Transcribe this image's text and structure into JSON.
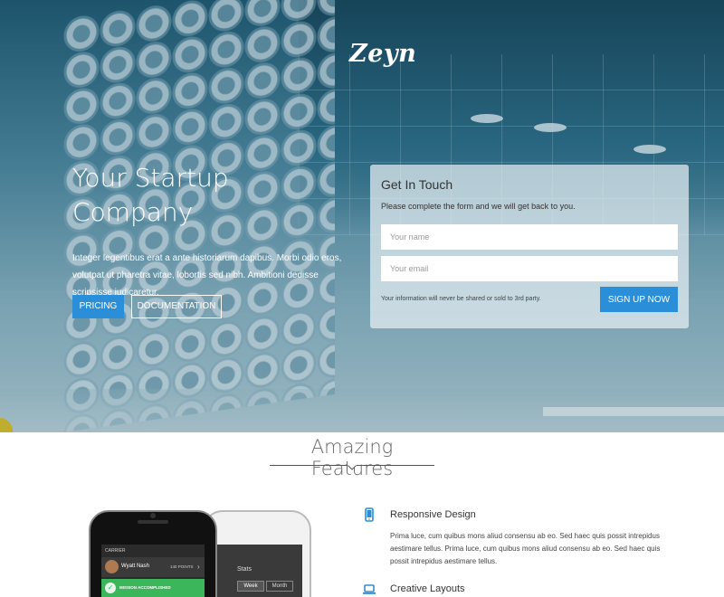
{
  "brand": {
    "logo": "Zeyn"
  },
  "hero": {
    "headline_line1": "Your Startup",
    "headline_line2": "Company",
    "lead": "Integer legentibus erat a ante historiarum dapibus. Morbi odio eros, volutpat ut pharetra vitae, lobortis sed nibh. Ambitioni dedisse scripsisse iudicaretur.",
    "pricing_label": "PRICING",
    "docs_label": "DOCUMENTATION"
  },
  "contact_form": {
    "title": "Get In Touch",
    "subtitle": "Please complete the form and we will get back to you.",
    "name_placeholder": "Your name",
    "email_placeholder": "Your email",
    "privacy_note": "Your information will never be shared or sold to 3rd party.",
    "submit_label": "SIGN UP NOW"
  },
  "features": {
    "title": "Amazing Features",
    "items": [
      {
        "icon": "mobile-phone-icon",
        "title": "Responsive Design",
        "description": "Prima luce, cum quibus mons aliud  consensu ab eo. Sed haec quis possit intrepidus aestimare tellus. Prima luce, cum quibus mons aliud  consensu ab eo. Sed haec quis possit intrepidus aestimare tellus."
      },
      {
        "icon": "laptop-icon",
        "title": "Creative Layouts"
      }
    ]
  },
  "phone_mockup": {
    "carrier": "CARRIER",
    "user_name": "Wyatt Nash",
    "points": "140 POINTS",
    "mission": "MISSION ACCOMPLISHED",
    "stats_label": "Stats",
    "tab_week": "Week",
    "tab_month": "Month"
  },
  "colors": {
    "accent": "#2a8fd8",
    "success": "#3cb65a"
  }
}
